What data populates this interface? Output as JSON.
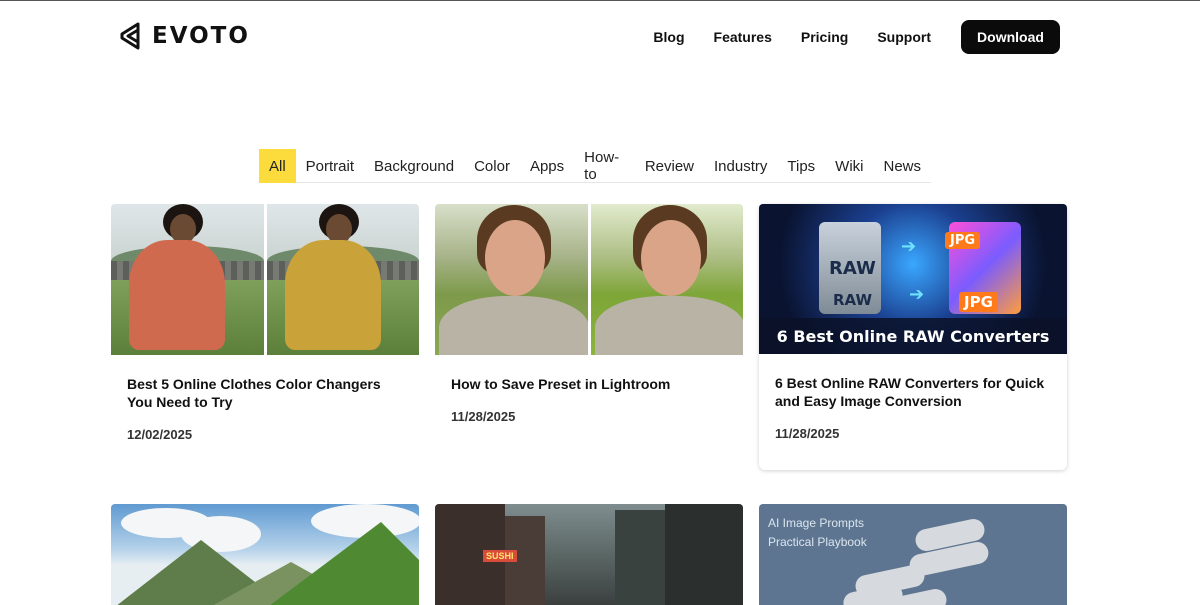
{
  "brand": {
    "name": "EVOTO"
  },
  "nav": {
    "links": [
      "Blog",
      "Features",
      "Pricing",
      "Support"
    ],
    "download_label": "Download"
  },
  "tabs": [
    "All",
    "Portrait",
    "Background",
    "Color",
    "Apps",
    "How-to",
    "Review",
    "Industry",
    "Tips",
    "Wiki",
    "News"
  ],
  "active_tab": "All",
  "posts": [
    {
      "title": "Best 5 Online Clothes Color Changers You Need to Try",
      "date": "12/02/2025"
    },
    {
      "title": "How to Save Preset in Lightroom",
      "date": "11/28/2025"
    },
    {
      "title": "6 Best Online RAW Converters for Quick and Easy Image Conversion",
      "date": "11/28/2025",
      "thumb": {
        "raw_label": "RAW",
        "jpg_label": "JPG",
        "banner": "6 Best Online RAW Converters"
      }
    },
    {
      "title": "",
      "date": ""
    },
    {
      "title": "",
      "date": "",
      "thumb": {
        "sign": "SUSHI"
      }
    },
    {
      "title": "",
      "date": "",
      "thumb": {
        "line1": "AI Image Prompts",
        "line2": "Practical Playbook"
      }
    }
  ],
  "colors": {
    "accent_tab": "#fcdc3c",
    "button_bg": "#0b0b0b"
  }
}
